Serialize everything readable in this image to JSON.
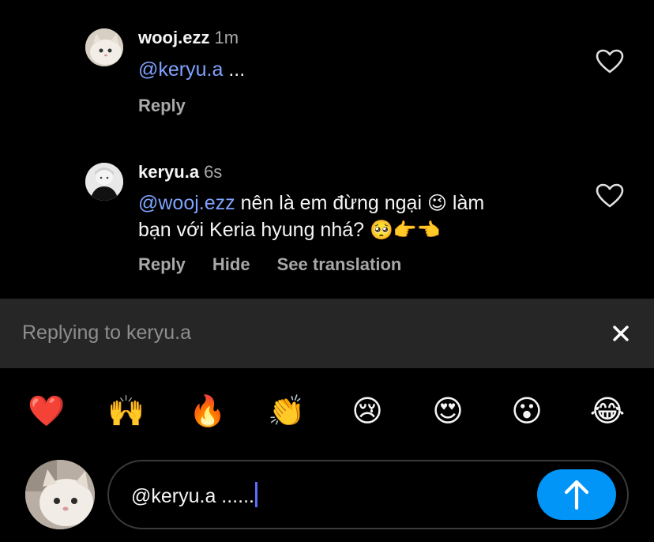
{
  "comments": [
    {
      "username": "wooj.ezz",
      "time": "1m",
      "mention": "@keryu.a",
      "text": " ...",
      "actions": [
        "Reply"
      ]
    },
    {
      "username": "keryu.a",
      "time": "6s",
      "mention": "@wooj.ezz",
      "text_line1": " nên là em đừng ngại ",
      "emoji1": "😉",
      "text_line1b": " làm",
      "text_line2": "bạn với Keria hyung nhá? ",
      "emoji2": "🥺👉👈",
      "actions": [
        "Reply",
        "Hide",
        "See translation"
      ]
    }
  ],
  "reply_bar": {
    "label": "Replying to keryu.a"
  },
  "quick_emojis": [
    "❤️",
    "🙌",
    "🔥",
    "👏",
    "😢",
    "😍",
    "😮",
    "😂"
  ],
  "composer": {
    "value": "@keryu.a ......"
  },
  "colors": {
    "accent": "#0095f6",
    "mention": "#7fa3ff",
    "reply_bar_bg": "#262626"
  },
  "icons": {
    "like": "heart-outline-icon",
    "close": "close-icon",
    "send": "arrow-up-icon"
  }
}
